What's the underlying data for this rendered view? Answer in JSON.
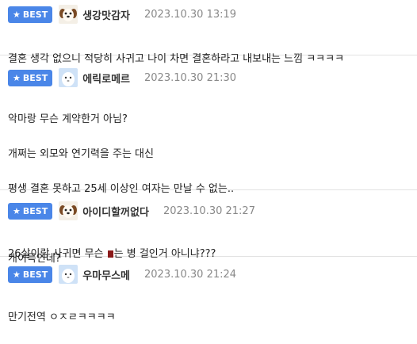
{
  "comments": [
    {
      "badge": "BEST",
      "nickname": "생강맛감자",
      "date": "2023.10.30 13:19",
      "avatar": "dog-face-avatar",
      "lines": [
        "결혼 생각 없으니 적당히 사귀고 나이 차면 결혼하라고 내보내는 느낌 ㅋㅋㅋㅋ"
      ]
    },
    {
      "badge": "BEST",
      "nickname": "에릭로메르",
      "date": "2023.10.30 21:30",
      "avatar": "white-animal-avatar",
      "lines": [
        "악마랑 무슨 계약한거 아님?",
        "개쩌는 외모와 연기력을 주는 대신",
        "평생 결혼 못하고 25세 이상인 여자는 만날 수 없는..",
        "",
        "개이득인데?"
      ]
    },
    {
      "badge": "BEST",
      "nickname": "아이디할꺼없다",
      "date": "2023.10.30 21:27",
      "avatar": "dog-face-avatar",
      "line_before": "26살이랑 사귀면 무슨",
      "line_after": "는 병 걸인거 아니냐???"
    },
    {
      "badge": "BEST",
      "nickname": "우마무스메",
      "date": "2023.10.30 21:24",
      "avatar": "white-animal-avatar",
      "lines": [
        "만기전역 ㅇㅈㄹㅋㅋㅋㅋ"
      ]
    }
  ],
  "colors": {
    "badge": "#4a86e8",
    "date": "#888888",
    "divider": "#e2e2e2"
  },
  "icons": {
    "badge_star": "star-icon"
  }
}
